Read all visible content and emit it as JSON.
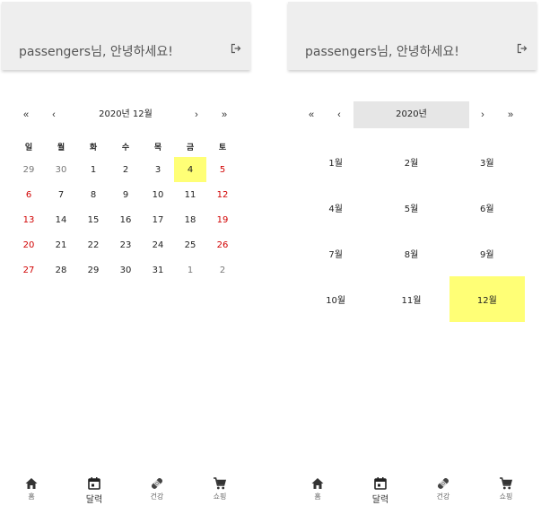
{
  "colors": {
    "accent_selected": "#ffff76",
    "weekend": "#d10000",
    "header_bg": "#eeeeee"
  },
  "left_screen": {
    "header": {
      "greeting": "passengers님, 안녕하세요!",
      "logout_icon": "logout-icon"
    },
    "calendar": {
      "nav": {
        "prev_year": "«",
        "prev_month": "‹",
        "label": "2020년 12월",
        "next_month": "›",
        "next_year": "»"
      },
      "weekdays": [
        "일",
        "월",
        "화",
        "수",
        "목",
        "금",
        "토"
      ],
      "days": [
        {
          "d": "29",
          "type": "other"
        },
        {
          "d": "30",
          "type": "other"
        },
        {
          "d": "1",
          "type": "normal"
        },
        {
          "d": "2",
          "type": "normal"
        },
        {
          "d": "3",
          "type": "normal"
        },
        {
          "d": "4",
          "type": "selected"
        },
        {
          "d": "5",
          "type": "weekend"
        },
        {
          "d": "6",
          "type": "weekend"
        },
        {
          "d": "7",
          "type": "normal"
        },
        {
          "d": "8",
          "type": "normal"
        },
        {
          "d": "9",
          "type": "normal"
        },
        {
          "d": "10",
          "type": "normal"
        },
        {
          "d": "11",
          "type": "normal"
        },
        {
          "d": "12",
          "type": "weekend"
        },
        {
          "d": "13",
          "type": "weekend"
        },
        {
          "d": "14",
          "type": "normal"
        },
        {
          "d": "15",
          "type": "normal"
        },
        {
          "d": "16",
          "type": "normal"
        },
        {
          "d": "17",
          "type": "normal"
        },
        {
          "d": "18",
          "type": "normal"
        },
        {
          "d": "19",
          "type": "weekend"
        },
        {
          "d": "20",
          "type": "weekend"
        },
        {
          "d": "21",
          "type": "normal"
        },
        {
          "d": "22",
          "type": "normal"
        },
        {
          "d": "23",
          "type": "normal"
        },
        {
          "d": "24",
          "type": "normal"
        },
        {
          "d": "25",
          "type": "normal"
        },
        {
          "d": "26",
          "type": "weekend"
        },
        {
          "d": "27",
          "type": "weekend"
        },
        {
          "d": "28",
          "type": "normal"
        },
        {
          "d": "29",
          "type": "normal"
        },
        {
          "d": "30",
          "type": "normal"
        },
        {
          "d": "31",
          "type": "normal"
        },
        {
          "d": "1",
          "type": "other"
        },
        {
          "d": "2",
          "type": "other"
        }
      ]
    },
    "bottom_nav": [
      {
        "label": "홈",
        "icon": "home-icon",
        "active": false
      },
      {
        "label": "달력",
        "icon": "calendar-icon",
        "active": true
      },
      {
        "label": "건강",
        "icon": "bandage-icon",
        "active": false
      },
      {
        "label": "쇼핑",
        "icon": "cart-icon",
        "active": false
      }
    ]
  },
  "right_screen": {
    "header": {
      "greeting": "passengers님, 안녕하세요!",
      "logout_icon": "logout-icon"
    },
    "calendar": {
      "nav": {
        "prev_decade": "«",
        "prev_year": "‹",
        "label": "2020년",
        "next_year": "›",
        "next_decade": "»"
      },
      "months": [
        {
          "label": "1월",
          "selected": false
        },
        {
          "label": "2월",
          "selected": false
        },
        {
          "label": "3월",
          "selected": false
        },
        {
          "label": "4월",
          "selected": false
        },
        {
          "label": "5월",
          "selected": false
        },
        {
          "label": "6월",
          "selected": false
        },
        {
          "label": "7월",
          "selected": false
        },
        {
          "label": "8월",
          "selected": false
        },
        {
          "label": "9월",
          "selected": false
        },
        {
          "label": "10월",
          "selected": false
        },
        {
          "label": "11월",
          "selected": false
        },
        {
          "label": "12월",
          "selected": true
        }
      ]
    },
    "bottom_nav": [
      {
        "label": "홈",
        "icon": "home-icon",
        "active": false
      },
      {
        "label": "달력",
        "icon": "calendar-icon",
        "active": true
      },
      {
        "label": "건강",
        "icon": "bandage-icon",
        "active": false
      },
      {
        "label": "쇼핑",
        "icon": "cart-icon",
        "active": false
      }
    ]
  }
}
